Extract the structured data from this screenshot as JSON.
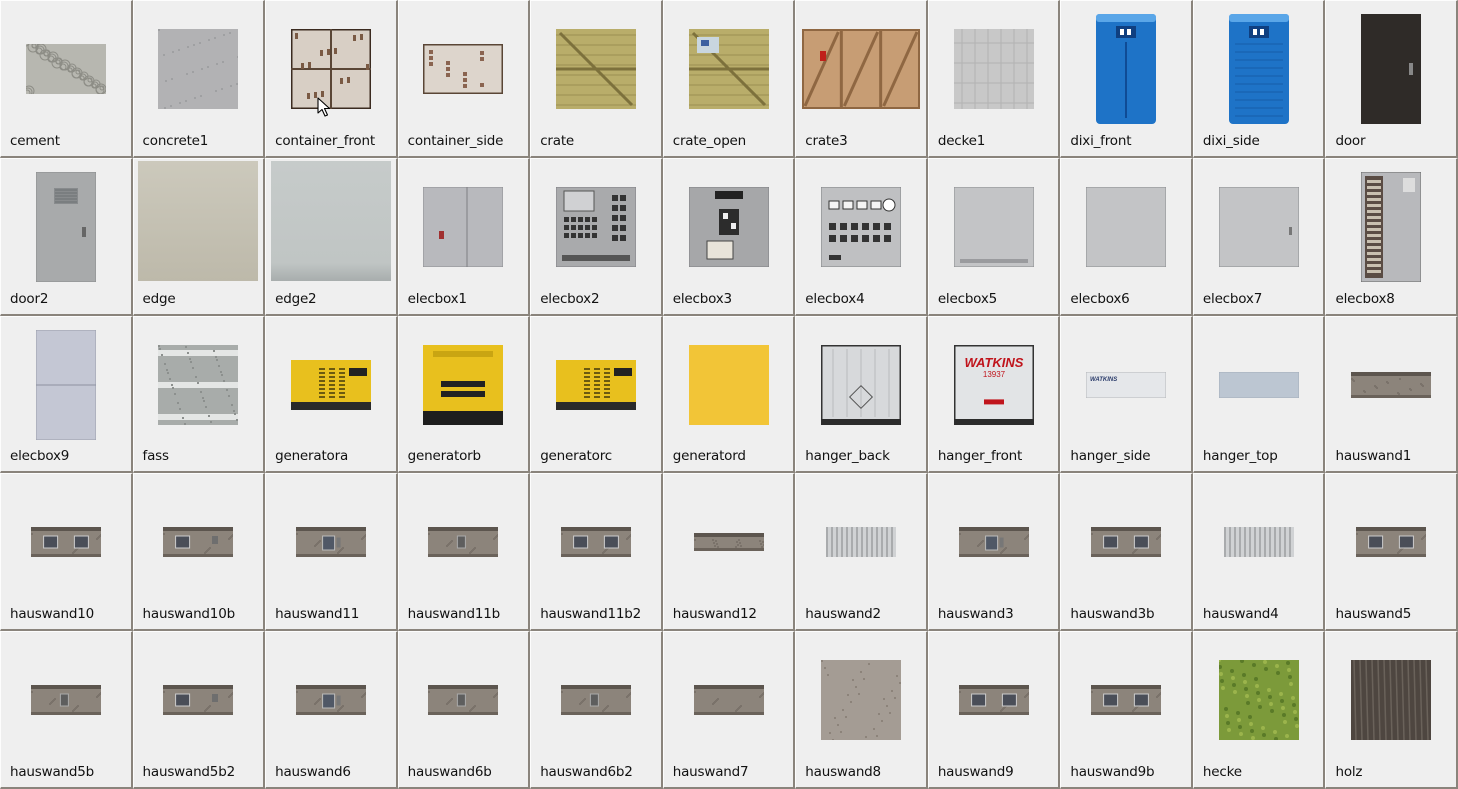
{
  "textures": [
    {
      "label": "cement",
      "thumb": "cement",
      "aspect": "wide"
    },
    {
      "label": "concrete1",
      "thumb": "concrete",
      "aspect": "square"
    },
    {
      "label": "container_front",
      "thumb": "container-front",
      "aspect": "square"
    },
    {
      "label": "container_side",
      "thumb": "container-side",
      "aspect": "wide"
    },
    {
      "label": "crate",
      "thumb": "crate",
      "aspect": "square"
    },
    {
      "label": "crate_open",
      "thumb": "crate-open",
      "aspect": "square"
    },
    {
      "label": "crate3",
      "thumb": "crate3",
      "aspect": "wide-tall"
    },
    {
      "label": "decke1",
      "thumb": "decke",
      "aspect": "square"
    },
    {
      "label": "dixi_front",
      "thumb": "dixi-front",
      "aspect": "tall"
    },
    {
      "label": "dixi_side",
      "thumb": "dixi-side",
      "aspect": "tall"
    },
    {
      "label": "door",
      "thumb": "door",
      "aspect": "tall"
    },
    {
      "label": "door2",
      "thumb": "door2",
      "aspect": "tall"
    },
    {
      "label": "edge",
      "thumb": "edge",
      "aspect": "full"
    },
    {
      "label": "edge2",
      "thumb": "edge2",
      "aspect": "full"
    },
    {
      "label": "elecbox1",
      "thumb": "elecbox1",
      "aspect": "square"
    },
    {
      "label": "elecbox2",
      "thumb": "elecbox2",
      "aspect": "square"
    },
    {
      "label": "elecbox3",
      "thumb": "elecbox3",
      "aspect": "square"
    },
    {
      "label": "elecbox4",
      "thumb": "elecbox4",
      "aspect": "square"
    },
    {
      "label": "elecbox5",
      "thumb": "elecbox5",
      "aspect": "square"
    },
    {
      "label": "elecbox6",
      "thumb": "elecbox6",
      "aspect": "square"
    },
    {
      "label": "elecbox7",
      "thumb": "elecbox7",
      "aspect": "square"
    },
    {
      "label": "elecbox8",
      "thumb": "elecbox8",
      "aspect": "tall"
    },
    {
      "label": "elecbox9",
      "thumb": "elecbox9",
      "aspect": "tall"
    },
    {
      "label": "fass",
      "thumb": "fass",
      "aspect": "square"
    },
    {
      "label": "generatora",
      "thumb": "generatora",
      "aspect": "wide"
    },
    {
      "label": "generatorb",
      "thumb": "generatorb",
      "aspect": "square"
    },
    {
      "label": "generatorc",
      "thumb": "generatorc",
      "aspect": "wide"
    },
    {
      "label": "generatord",
      "thumb": "generatord",
      "aspect": "square"
    },
    {
      "label": "hanger_back",
      "thumb": "hanger-back",
      "aspect": "square"
    },
    {
      "label": "hanger_front",
      "thumb": "hanger-front",
      "aspect": "square",
      "brand": "WATKINS",
      "number": "13937"
    },
    {
      "label": "hanger_side",
      "thumb": "hanger-side",
      "aspect": "strip",
      "brand": "WATKINS"
    },
    {
      "label": "hanger_top",
      "thumb": "hanger-top",
      "aspect": "strip"
    },
    {
      "label": "hauswand1",
      "thumb": "wall-plain",
      "aspect": "strip"
    },
    {
      "label": "hauswand10",
      "thumb": "wall-windows",
      "aspect": "wall"
    },
    {
      "label": "hauswand10b",
      "thumb": "wall-window-b",
      "aspect": "wall"
    },
    {
      "label": "hauswand11",
      "thumb": "wall-door",
      "aspect": "wall"
    },
    {
      "label": "hauswand11b",
      "thumb": "wall-door-b",
      "aspect": "wall"
    },
    {
      "label": "hauswand11b2",
      "thumb": "wall-windows",
      "aspect": "wall"
    },
    {
      "label": "hauswand12",
      "thumb": "wall-plain",
      "aspect": "thin"
    },
    {
      "label": "hauswand2",
      "thumb": "corrugated",
      "aspect": "wall"
    },
    {
      "label": "hauswand3",
      "thumb": "wall-door",
      "aspect": "wall"
    },
    {
      "label": "hauswand3b",
      "thumb": "wall-windows",
      "aspect": "wall"
    },
    {
      "label": "hauswand4",
      "thumb": "corrugated",
      "aspect": "wall"
    },
    {
      "label": "hauswand5",
      "thumb": "wall-windows",
      "aspect": "wall"
    },
    {
      "label": "hauswand5b",
      "thumb": "wall-door-b",
      "aspect": "wall"
    },
    {
      "label": "hauswand5b2",
      "thumb": "wall-window-b",
      "aspect": "wall"
    },
    {
      "label": "hauswand6",
      "thumb": "wall-door",
      "aspect": "wall"
    },
    {
      "label": "hauswand6b",
      "thumb": "wall-door-b",
      "aspect": "wall"
    },
    {
      "label": "hauswand6b2",
      "thumb": "wall-door-b",
      "aspect": "wall"
    },
    {
      "label": "hauswand7",
      "thumb": "wall-plain",
      "aspect": "wall"
    },
    {
      "label": "hauswand8",
      "thumb": "concrete-brown",
      "aspect": "square"
    },
    {
      "label": "hauswand9",
      "thumb": "wall-windows",
      "aspect": "wall"
    },
    {
      "label": "hauswand9b",
      "thumb": "wall-windows",
      "aspect": "wall"
    },
    {
      "label": "hecke",
      "thumb": "hedge",
      "aspect": "square"
    },
    {
      "label": "holz",
      "thumb": "wood",
      "aspect": "square"
    }
  ],
  "colors": {
    "tile_bg": "#efefef",
    "grid_line": "#8c867e",
    "crate": "#b9ad6a",
    "crate3": "#c79d74",
    "dixi_blue": "#1e73c7",
    "generator_yellow": "#e8c01e",
    "watkins_red": "#c0141c",
    "hedge": "#7c9a3a"
  }
}
